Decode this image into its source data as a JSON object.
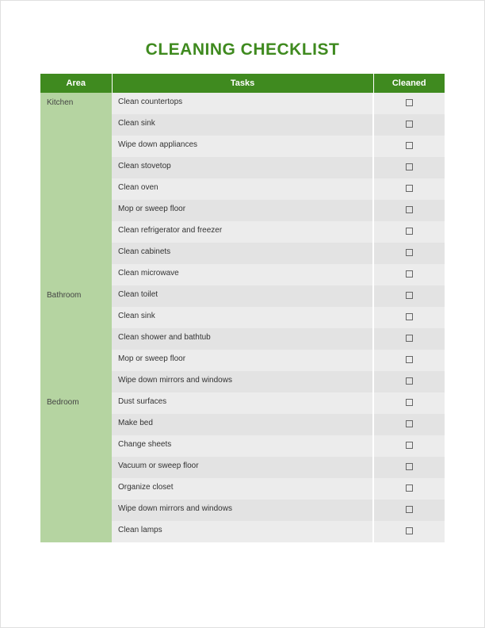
{
  "title": "CLEANING CHECKLIST",
  "columns": {
    "area": "Area",
    "tasks": "Tasks",
    "cleaned": "Cleaned"
  },
  "sections": [
    {
      "area": "Kitchen",
      "tasks": [
        "Clean countertops",
        "Clean sink",
        "Wipe down appliances",
        "Clean stovetop",
        "Clean oven",
        "Mop or sweep floor",
        "Clean refrigerator and freezer",
        "Clean cabinets",
        "Clean microwave"
      ]
    },
    {
      "area": "Bathroom",
      "tasks": [
        "Clean toilet",
        "Clean sink",
        "Clean shower and bathtub",
        "Mop or sweep floor",
        "Wipe down mirrors and windows"
      ]
    },
    {
      "area": "Bedroom",
      "tasks": [
        "Dust surfaces",
        "Make bed",
        "Change sheets",
        "Vacuum or sweep floor",
        "Organize closet",
        "Wipe down mirrors and windows",
        "Clean lamps"
      ]
    }
  ]
}
